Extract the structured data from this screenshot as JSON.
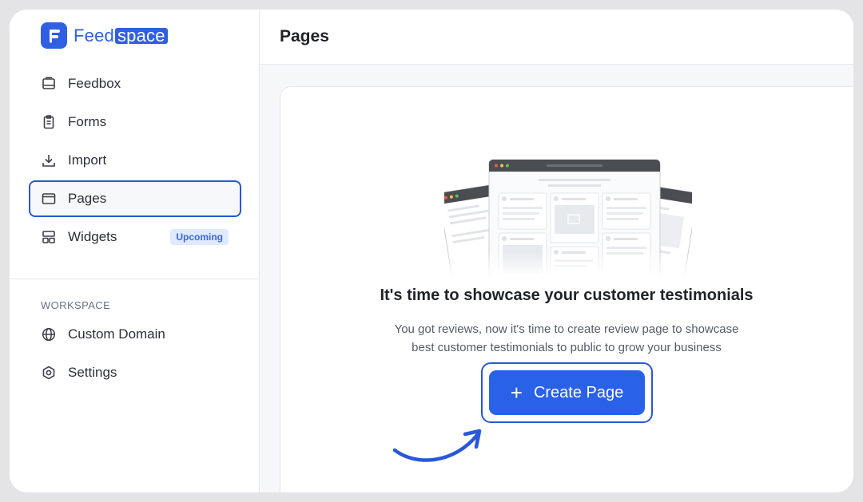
{
  "brand": {
    "name_prefix": "Feed",
    "name_highlight": "space",
    "color": "#2f5fe3"
  },
  "sidebar": {
    "items": [
      {
        "label": "Feedbox",
        "icon": "inbox-icon"
      },
      {
        "label": "Forms",
        "icon": "clipboard-icon"
      },
      {
        "label": "Import",
        "icon": "download-icon"
      },
      {
        "label": "Pages",
        "icon": "window-icon",
        "active": true
      },
      {
        "label": "Widgets",
        "icon": "grid-icon",
        "badge": "Upcoming"
      }
    ],
    "workspace_label": "WORKSPACE",
    "workspace_items": [
      {
        "label": "Custom Domain",
        "icon": "globe-icon"
      },
      {
        "label": "Settings",
        "icon": "gear-icon"
      }
    ]
  },
  "header": {
    "title": "Pages"
  },
  "empty_state": {
    "title": "It's time to showcase your customer testimonials",
    "description_line1": "You got reviews, now it's time to create review page to showcase",
    "description_line2": "best customer testimonials to public to grow your business",
    "cta_label": "Create Page",
    "cta_icon": "plus-icon"
  },
  "colors": {
    "accent": "#2962e8",
    "highlight_outline": "#2957d9",
    "badge_bg": "#dfe9ff"
  }
}
